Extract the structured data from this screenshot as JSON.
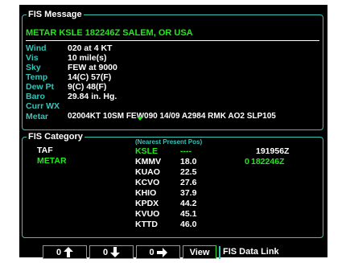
{
  "fis_message": {
    "title": "FIS Message",
    "header": "METAR KSLE 182246Z   SALEM, OR USA",
    "rows": [
      {
        "label": "Wind",
        "value": "020 at 4 KT"
      },
      {
        "label": "Vis",
        "value": "10 mile(s)"
      },
      {
        "label": "Sky",
        "value": "FEW at 9000"
      },
      {
        "label": "Temp",
        "value": "14(C) 57(F)"
      },
      {
        "label": "Dew Pt",
        "value": "9(C) 48(F)"
      },
      {
        "label": "Baro",
        "value": "29.84 in. Hg."
      },
      {
        "label": "Curr WX",
        "value": ""
      },
      {
        "label": "Metar",
        "value": "02004KT 10SM FEW090 14/09 A2984 RMK AO2 SLP105"
      }
    ]
  },
  "fis_category": {
    "title": "FIS Category",
    "items": [
      "TAF",
      "METAR"
    ],
    "nearest_header": "(Nearest Present Pos)",
    "stations": [
      {
        "id": "KSLE",
        "dist": "----",
        "time": "191956Z"
      },
      {
        "id": "KMMV",
        "dist": "18.0",
        "time": "182246Z"
      },
      {
        "id": "KUAO",
        "dist": "22.5",
        "time": ""
      },
      {
        "id": "KCVO",
        "dist": "27.6",
        "time": ""
      },
      {
        "id": "KHIO",
        "dist": "37.9",
        "time": ""
      },
      {
        "id": "KPDX",
        "dist": "44.2",
        "time": ""
      },
      {
        "id": "KVUO",
        "dist": "45.1",
        "time": ""
      },
      {
        "id": "KTTD",
        "dist": "46.0",
        "time": ""
      }
    ],
    "marker_glyph": "0"
  },
  "softkeys": {
    "up_label": "0",
    "down_label": "0",
    "enter_label": "0",
    "view_label": "View",
    "datalink_label": "FIS Data Link"
  },
  "colors": {
    "border": "#35c4b8",
    "highlight": "#22e81c",
    "text": "#ffffff",
    "background": "#000000"
  }
}
